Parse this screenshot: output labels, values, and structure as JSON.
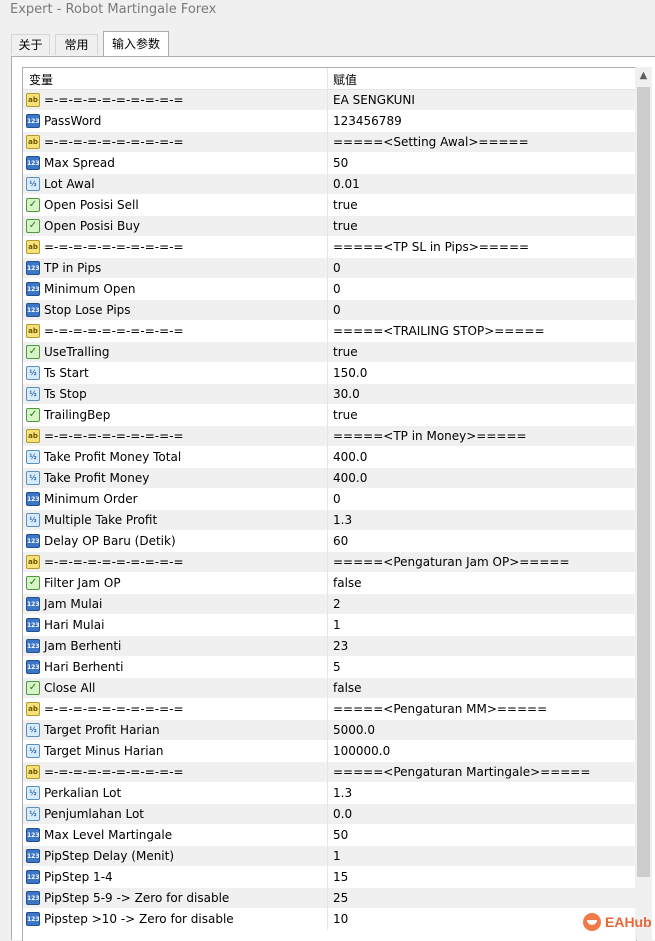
{
  "window": {
    "title": "Expert - Robot Martingale Forex"
  },
  "tabs": [
    {
      "label": "关于",
      "active": false
    },
    {
      "label": "常用",
      "active": false
    },
    {
      "label": "输入参数",
      "active": true
    }
  ],
  "grid": {
    "headers": {
      "variable": "变量",
      "value": "赋值"
    },
    "rows": [
      {
        "type": "string",
        "name": "=-=-=-=-=-=-=-=-=-=",
        "value": "EA SENGKUNI"
      },
      {
        "type": "int",
        "name": "PassWord",
        "value": "123456789"
      },
      {
        "type": "string",
        "name": "=-=-=-=-=-=-=-=-=-=",
        "value": "=====<Setting Awal>====="
      },
      {
        "type": "int",
        "name": "Max Spread",
        "value": "50"
      },
      {
        "type": "double",
        "name": "Lot Awal",
        "value": "0.01"
      },
      {
        "type": "bool",
        "name": "Open Posisi Sell",
        "value": "true"
      },
      {
        "type": "bool",
        "name": "Open Posisi Buy",
        "value": "true"
      },
      {
        "type": "string",
        "name": "=-=-=-=-=-=-=-=-=-=",
        "value": "=====<TP SL in Pips>====="
      },
      {
        "type": "int",
        "name": "TP in Pips",
        "value": "0"
      },
      {
        "type": "int",
        "name": "Minimum Open",
        "value": "0"
      },
      {
        "type": "int",
        "name": "Stop Lose Pips",
        "value": "0"
      },
      {
        "type": "string",
        "name": "=-=-=-=-=-=-=-=-=-=",
        "value": "=====<TRAILING STOP>====="
      },
      {
        "type": "bool",
        "name": "UseTralling",
        "value": "true"
      },
      {
        "type": "double",
        "name": "Ts Start",
        "value": "150.0"
      },
      {
        "type": "double",
        "name": "Ts Stop",
        "value": "30.0"
      },
      {
        "type": "bool",
        "name": "TrailingBep",
        "value": "true"
      },
      {
        "type": "string",
        "name": "=-=-=-=-=-=-=-=-=-=",
        "value": "=====<TP in Money>====="
      },
      {
        "type": "double",
        "name": "Take Profit Money Total",
        "value": "400.0"
      },
      {
        "type": "double",
        "name": "Take Profit Money",
        "value": "400.0"
      },
      {
        "type": "int",
        "name": "Minimum Order",
        "value": "0"
      },
      {
        "type": "double",
        "name": "Multiple Take Profit",
        "value": "1.3"
      },
      {
        "type": "int",
        "name": "Delay OP Baru (Detik)",
        "value": "60"
      },
      {
        "type": "string",
        "name": "=-=-=-=-=-=-=-=-=-=",
        "value": "=====<Pengaturan Jam OP>====="
      },
      {
        "type": "bool",
        "name": "Filter Jam OP",
        "value": "false"
      },
      {
        "type": "int",
        "name": "Jam Mulai",
        "value": "2"
      },
      {
        "type": "int",
        "name": "Hari Mulai",
        "value": "1"
      },
      {
        "type": "int",
        "name": "Jam Berhenti",
        "value": "23"
      },
      {
        "type": "int",
        "name": "Hari Berhenti",
        "value": "5"
      },
      {
        "type": "bool",
        "name": "Close All",
        "value": "false"
      },
      {
        "type": "string",
        "name": "=-=-=-=-=-=-=-=-=-=",
        "value": "=====<Pengaturan MM>====="
      },
      {
        "type": "double",
        "name": "Target Profit Harian",
        "value": "5000.0"
      },
      {
        "type": "double",
        "name": "Target Minus Harian",
        "value": "100000.0"
      },
      {
        "type": "string",
        "name": "=-=-=-=-=-=-=-=-=-=",
        "value": "=====<Pengaturan Martingale>====="
      },
      {
        "type": "double",
        "name": "Perkalian Lot",
        "value": "1.3"
      },
      {
        "type": "double",
        "name": "Penjumlahan Lot",
        "value": "0.0"
      },
      {
        "type": "int",
        "name": "Max Level Martingale",
        "value": "50"
      },
      {
        "type": "int",
        "name": "PipStep Delay (Menit)",
        "value": "1"
      },
      {
        "type": "int",
        "name": "PipStep 1-4",
        "value": "15"
      },
      {
        "type": "int",
        "name": "PipStep 5-9 -> Zero for disable",
        "value": "25"
      },
      {
        "type": "int",
        "name": "Pipstep >10 -> Zero for disable",
        "value": "10"
      }
    ]
  },
  "icon_glyphs": {
    "string": "ab",
    "int": "123",
    "double": "½",
    "bool": "✓"
  },
  "watermark": {
    "text": "EAHub"
  }
}
